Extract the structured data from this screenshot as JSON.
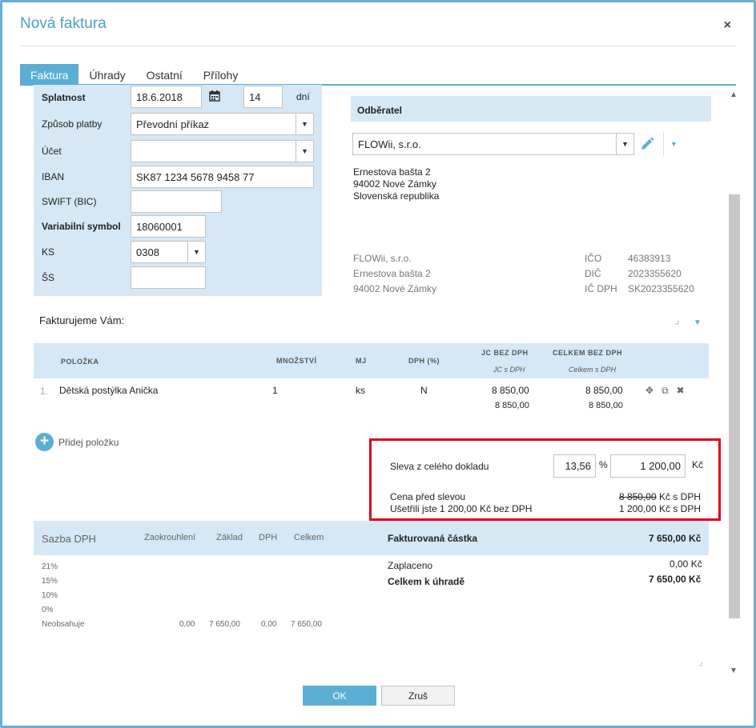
{
  "dialog": {
    "title": "Nová faktura",
    "close_icon": "×"
  },
  "tabs": [
    {
      "label": "Faktura",
      "active": true
    },
    {
      "label": "Úhrady",
      "active": false
    },
    {
      "label": "Ostatní",
      "active": false
    },
    {
      "label": "Přílohy",
      "active": false
    }
  ],
  "form": {
    "splatnost": {
      "label": "Splatnost",
      "date": "18.6.2018",
      "days": "14",
      "days_unit": "dní"
    },
    "zpusob_platby": {
      "label": "Způsob platby",
      "value": "Převodní příkaz"
    },
    "ucet": {
      "label": "Účet",
      "value": ""
    },
    "iban": {
      "label": "IBAN",
      "value": "SK87 1234 5678 9458 77"
    },
    "swift": {
      "label": "SWIFT (BIC)",
      "value": ""
    },
    "vs": {
      "label": "Variabilní symbol",
      "value": "18060001"
    },
    "ks": {
      "label": "KS",
      "value": "0308"
    },
    "ss": {
      "label": "ŠS",
      "value": ""
    }
  },
  "customer": {
    "header": "Odběratel",
    "selected": "FLOWii, s.r.o.",
    "address": [
      "Ernestova bašta 2",
      "94002 Nové Zámky",
      "Slovenská republika"
    ],
    "supplier": [
      "FLOWii, s.r.o.",
      "Ernestova bašta 2",
      "94002 Nové Zámky"
    ],
    "ids": [
      {
        "key": "IČO",
        "value": "46383913"
      },
      {
        "key": "DIČ",
        "value": "2023355620"
      },
      {
        "key": "IČ DPH",
        "value": "SK2023355620"
      }
    ]
  },
  "items": {
    "intro": "Fakturujeme Vám:",
    "columns": {
      "item": "POLOŽKA",
      "qty": "MNOŽSTVÍ",
      "unit": "MJ",
      "vat": "DPH (%)",
      "unit_price": "JC BEZ DPH",
      "unit_price_vat": "JC s DPH",
      "total": "CELKEM BEZ DPH",
      "total_vat": "Celkem s DPH"
    },
    "rows": [
      {
        "num": "1.",
        "name": "Dětská postýlka Anička",
        "qty": "1",
        "unit": "ks",
        "vat": "N",
        "unit_price": "8 850,00",
        "unit_price_vat": "8 850,00",
        "total": "8 850,00",
        "total_vat": "8 850,00"
      }
    ],
    "add_label": "Přidej položku"
  },
  "discount": {
    "label": "Sleva z celého dokladu",
    "percent": "13,56",
    "percent_sign": "%",
    "amount": "1 200,00",
    "currency": "Kč",
    "price_before_label": "Cena před slevou",
    "price_before_value": "8 850,00",
    "price_before_suffix": " Kč s DPH",
    "saved_label": "Ušetřili jste 1 200,00 Kč bez DPH",
    "saved_value": "1 200,00 Kč s DPH"
  },
  "vat_summary": {
    "headers": {
      "rate": "Sazba DPH",
      "rounding": "Zaokrouhlení",
      "base": "Základ",
      "vat": "DPH",
      "total": "Celkem"
    },
    "rates": [
      "21%",
      "15%",
      "10%",
      "0%"
    ],
    "exempt": {
      "label": "Neobsahuje",
      "rounding": "0,00",
      "base": "7 650,00",
      "vat": "0,00",
      "total": "7 650,00"
    }
  },
  "totals": {
    "invoiced_label": "Fakturovaná částka",
    "invoiced_value": "7 650,00 Kč",
    "paid_label": "Zaplaceno",
    "paid_value": "0,00 Kč",
    "due_label": "Celkem k úhradě",
    "due_value": "7 650,00 Kč"
  },
  "buttons": {
    "ok": "OK",
    "cancel": "Zruš"
  }
}
